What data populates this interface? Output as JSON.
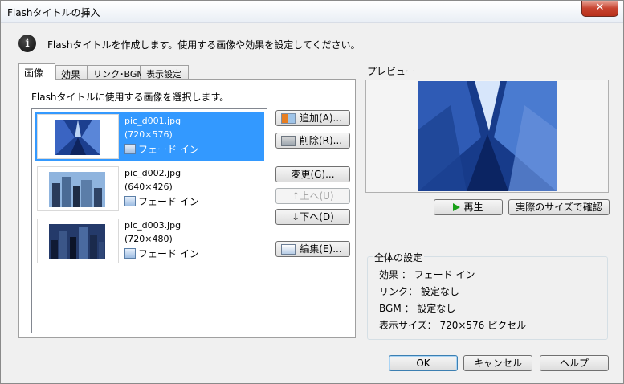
{
  "window": {
    "title": "Flashタイトルの挿入",
    "close_label": "✕"
  },
  "info": {
    "message": "Flashタイトルを作成します。使用する画像や効果を設定してください。"
  },
  "tabs": [
    {
      "label": "画像"
    },
    {
      "label": "効果"
    },
    {
      "label": "リンク･BGM"
    },
    {
      "label": "表示設定"
    }
  ],
  "panel": {
    "instruction": "Flashタイトルに使用する画像を選択します。"
  },
  "images": [
    {
      "name": "pic_d001.jpg",
      "size": "(720×576)",
      "effect": "フェード イン",
      "selected": true
    },
    {
      "name": "pic_d002.jpg",
      "size": "(640×426)",
      "effect": "フェード イン",
      "selected": false
    },
    {
      "name": "pic_d003.jpg",
      "size": "(720×480)",
      "effect": "フェード イン",
      "selected": false
    }
  ],
  "buttons": {
    "add": "追加(A)...",
    "delete": "削除(R)...",
    "change": "変更(G)...",
    "up": "↑上へ(U)",
    "down": "↓下へ(D)",
    "edit": "編集(E)..."
  },
  "preview": {
    "label": "プレビュー",
    "play": "再生",
    "actual_size": "実際のサイズで確認"
  },
  "settings": {
    "title": "全体の設定",
    "effect": "効果 ： フェード イン",
    "link": "リンク： 設定なし",
    "bgm": "BGM ： 設定なし",
    "display_size": "表示サイズ： 720×576 ピクセル"
  },
  "footer": {
    "ok": "OK",
    "cancel": "キャンセル",
    "help": "ヘルプ"
  }
}
